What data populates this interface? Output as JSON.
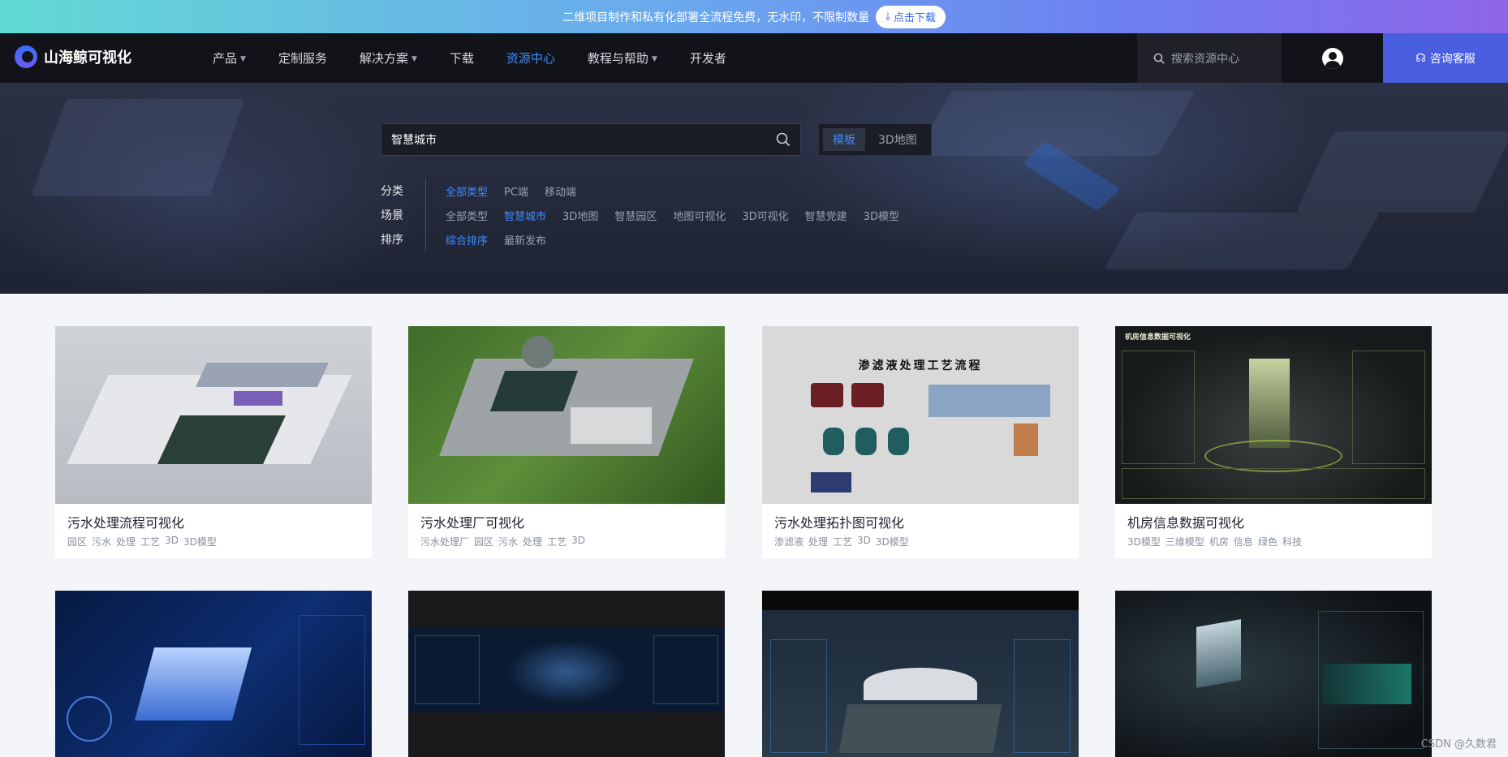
{
  "promo": {
    "text": "二维项目制作和私有化部署全流程免费，无水印，不限制数量",
    "button": "点击下载"
  },
  "nav": {
    "brand": "山海鲸可视化",
    "menu": [
      {
        "label": "产品",
        "dropdown": true
      },
      {
        "label": "定制服务",
        "dropdown": false
      },
      {
        "label": "解决方案",
        "dropdown": true
      },
      {
        "label": "下载",
        "dropdown": false
      },
      {
        "label": "资源中心",
        "dropdown": false,
        "active": true
      },
      {
        "label": "教程与帮助",
        "dropdown": true
      },
      {
        "label": "开发者",
        "dropdown": false
      }
    ],
    "search_placeholder": "搜索资源中心",
    "consult_label": "咨询客服"
  },
  "hero": {
    "search_value": "智慧城市",
    "toggle": [
      {
        "label": "模板",
        "active": true
      },
      {
        "label": "3D地图",
        "active": false
      }
    ],
    "filters": [
      {
        "label": "分类",
        "options": [
          "全部类型",
          "PC端",
          "移动端"
        ],
        "active": 0
      },
      {
        "label": "场景",
        "options": [
          "全部类型",
          "智慧城市",
          "3D地图",
          "智慧园区",
          "地图可视化",
          "3D可视化",
          "智慧党建",
          "3D模型"
        ],
        "active": 1
      },
      {
        "label": "排序",
        "options": [
          "综合排序",
          "最新发布"
        ],
        "active": 0
      }
    ]
  },
  "cards": [
    {
      "title": "污水处理流程可视化",
      "tags": [
        "园区",
        "污水",
        "处理",
        "工艺",
        "3D",
        "3D模型"
      ]
    },
    {
      "title": "污水处理厂可视化",
      "tags": [
        "污水处理厂",
        "园区",
        "污水",
        "处理",
        "工艺",
        "3D"
      ]
    },
    {
      "title": "污水处理拓扑图可视化",
      "tags": [
        "渗滤液",
        "处理",
        "工艺",
        "3D",
        "3D模型"
      ]
    },
    {
      "title": "机房信息数据可视化",
      "tags": [
        "3D模型",
        "三维模型",
        "机房",
        "信息",
        "绿色",
        "科技"
      ]
    },
    {
      "title": "",
      "tags": []
    },
    {
      "title": "",
      "tags": []
    },
    {
      "title": "",
      "tags": []
    },
    {
      "title": "",
      "tags": []
    }
  ],
  "thumb_texts": {
    "card3": "渗滤液处理工艺流程",
    "card4": "机房信息数据可视化"
  },
  "watermark": "CSDN @久数君"
}
